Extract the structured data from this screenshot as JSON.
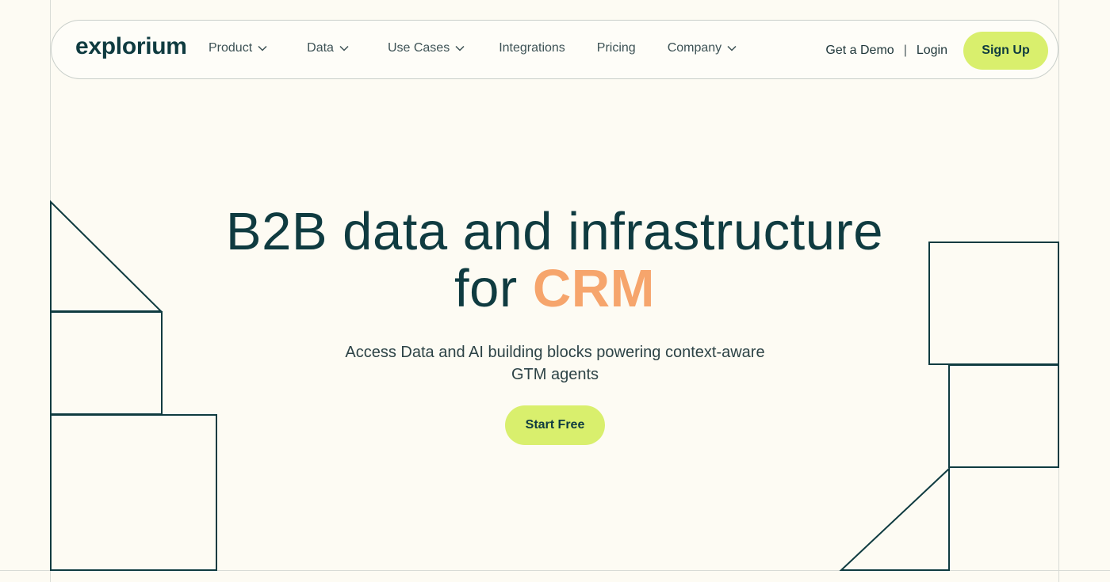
{
  "header": {
    "logo": "explorium",
    "nav": [
      {
        "label": "Product",
        "dropdown": true
      },
      {
        "label": "Data",
        "dropdown": true
      },
      {
        "label": "Use Cases",
        "dropdown": true
      },
      {
        "label": "Integrations",
        "dropdown": false
      },
      {
        "label": "Pricing",
        "dropdown": false
      },
      {
        "label": "Company",
        "dropdown": true
      }
    ],
    "get_demo": "Get a Demo",
    "separator": "|",
    "login": "Login",
    "signup": "Sign Up"
  },
  "hero": {
    "title_line1": "B2B data and infrastructure",
    "title_prefix": "for",
    "title_accent": "CRM",
    "subtitle_line1": "Access Data and AI building blocks powering context-aware",
    "subtitle_line2": "GTM agents",
    "cta": "Start Free"
  },
  "colors": {
    "background": "#fdfbf3",
    "primary_text": "#0f3b40",
    "accent": "#f6a56c",
    "button": "#d9ef6d"
  },
  "icons": {
    "dropdown": "chevron-down-icon"
  }
}
